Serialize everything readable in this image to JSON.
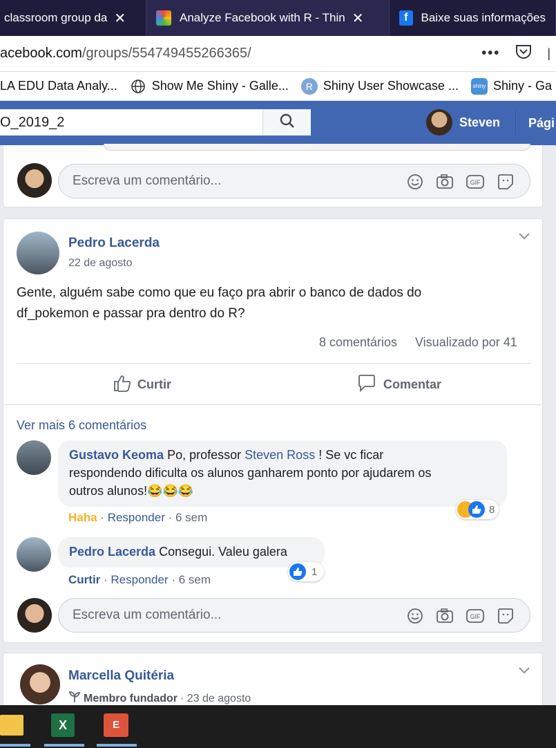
{
  "browser": {
    "tabs": [
      {
        "label": "classroom group da"
      },
      {
        "label": "Analyze Facebook with R - Thin"
      },
      {
        "label": "Baixe suas informações"
      }
    ],
    "url_prefix": "acebook.com",
    "url_path": "/groups/554749455266365/",
    "bookmarks": [
      {
        "label": "LA EDU Data Analy..."
      },
      {
        "label": "Show Me Shiny - Galle..."
      },
      {
        "label": "Shiny User Showcase ..."
      },
      {
        "label": "Shiny - Ga"
      }
    ]
  },
  "fb_header": {
    "search_value": "O_2019_2",
    "user_name": "Steven",
    "pages_label": "Pági"
  },
  "comment_placeholder": "Escreva um comentário...",
  "post": {
    "author": "Pedro Lacerda",
    "date": "22 de agosto",
    "text_line1": "Gente, alguém sabe como que eu faço pra abrir o banco de dados do",
    "text_line2": "df_pokemon e passar pra dentro do R?",
    "comments_count": "8 comentários",
    "seen_by": "Visualizado por 41",
    "like_label": "Curtir",
    "comment_label": "Comentar",
    "more_comments": "Ver mais 6 comentários"
  },
  "comments": [
    {
      "author": "Gustavo Keoma",
      "text_a": "Po, professor",
      "mention": "Steven Ross",
      "text_b": "! Se vc ficar",
      "line2": "respondendo dificulta os alunos ganharem ponto por ajudarem os",
      "line3": "outros alunos!😂😂😂",
      "reaction_label": "Haha",
      "reply_label": "Responder",
      "time": "6 sem",
      "reaction_count": "8"
    },
    {
      "author": "Pedro Lacerda",
      "text": "Consegui. Valeu galera",
      "reaction_label": "Curtir",
      "reply_label": "Responder",
      "time": "6 sem",
      "reaction_count": "1"
    }
  ],
  "next_post": {
    "author": "Marcella Quitéria",
    "badge": "Membro fundador",
    "date": "· 23 de agosto"
  },
  "colors": {
    "fb_blue": "#4267b2",
    "link_blue": "#385898",
    "haha_orange": "#f7b125"
  }
}
